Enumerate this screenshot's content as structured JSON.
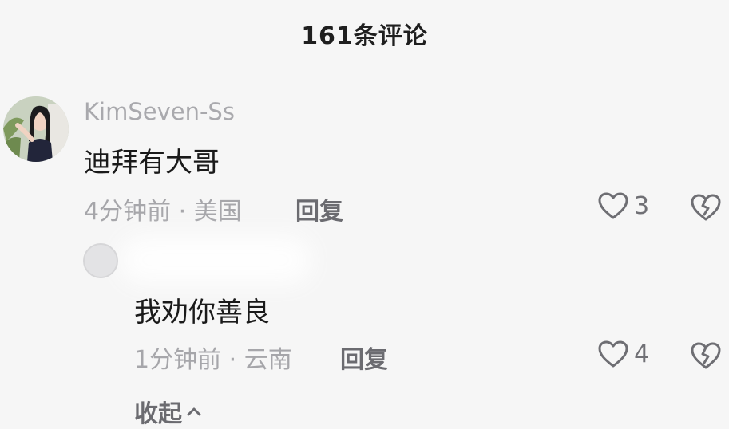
{
  "header": {
    "title": "161条评论"
  },
  "comment": {
    "username": "KimSeven-Ss",
    "text": "迪拜有大哥",
    "meta": "4分钟前 · 美国",
    "reply_label": "回复",
    "likes": "3"
  },
  "reply": {
    "text": "我劝你善良",
    "meta": "1分钟前 · 云南",
    "reply_label": "回复",
    "likes": "4"
  },
  "collapse": {
    "label": "收起"
  },
  "icons": {
    "like": "heart-outline-icon",
    "dislike": "broken-heart-icon",
    "collapse": "chevron-up-icon"
  }
}
